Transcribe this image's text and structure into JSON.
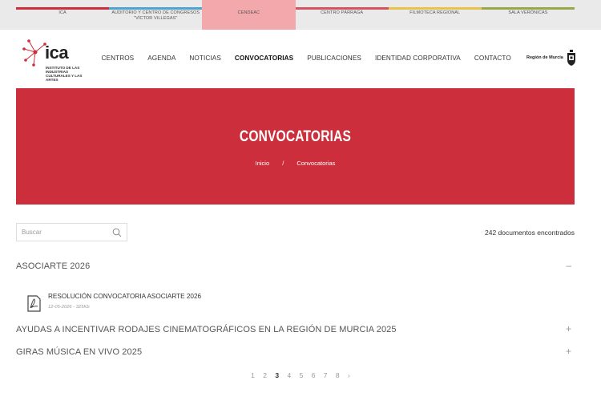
{
  "topbar": {
    "items": [
      {
        "label": "ICA",
        "color": "#cc2f3b"
      },
      {
        "label": "AUDITORIO Y CENTRO DE CONGRESOS \"VÍCTOR VILLEGAS\"",
        "color": "#4fa3cf"
      },
      {
        "label": "CENDEAC",
        "color": "#f3a8ac"
      },
      {
        "label": "CENTRO PÁRRAGA",
        "color": "#d35360"
      },
      {
        "label": "FILMOTECA REGIONAL",
        "color": "#e8c24a"
      },
      {
        "label": "SALA VERÓNICAS",
        "color": "#9aa64a"
      }
    ]
  },
  "header": {
    "logo_text": "ica",
    "logo_sub": "INSTITUTO DE LAS INDUSTRIAS CULTURALES Y LAS ARTES",
    "nav": [
      {
        "label": "CENTROS"
      },
      {
        "label": "AGENDA"
      },
      {
        "label": "NOTICIAS"
      },
      {
        "label": "CONVOCATORIAS"
      },
      {
        "label": "PUBLICACIONES"
      },
      {
        "label": "IDENTIDAD CORPORATIVA"
      },
      {
        "label": "CONTACTO"
      }
    ],
    "active_nav": "CONVOCATORIAS",
    "region_text": "Región de Murcia"
  },
  "hero": {
    "title": "CONVOCATORIAS",
    "breadcrumb_home": "Inicio",
    "breadcrumb_sep": "/",
    "breadcrumb_current": "Convocatorias",
    "color": "#cc2f3b"
  },
  "search": {
    "placeholder": "Buscar",
    "results_count": "242 documentos encontrados"
  },
  "accordion": [
    {
      "title": "ASOCIARTE 2026",
      "toggle": "–",
      "expanded": true,
      "documents": [
        {
          "title": "RESOLUCIÓN CONVOCATORIA ASOCIARTE 2026",
          "meta": "12-05-2026 - 325Kb",
          "icon": "pdf-icon"
        }
      ]
    },
    {
      "title": "AYUDAS A INCENTIVAR RODAJES CINEMATOGRÁFICOS EN LA REGIÓN DE MURCIA 2025",
      "toggle": "+",
      "expanded": false
    },
    {
      "title": "GIRAS MÚSICA EN VIVO 2025",
      "toggle": "+",
      "expanded": false
    }
  ],
  "pagination": {
    "pages": [
      "1",
      "2",
      "3",
      "4",
      "5",
      "6",
      "7",
      "8"
    ],
    "current": "3",
    "next": "›"
  }
}
